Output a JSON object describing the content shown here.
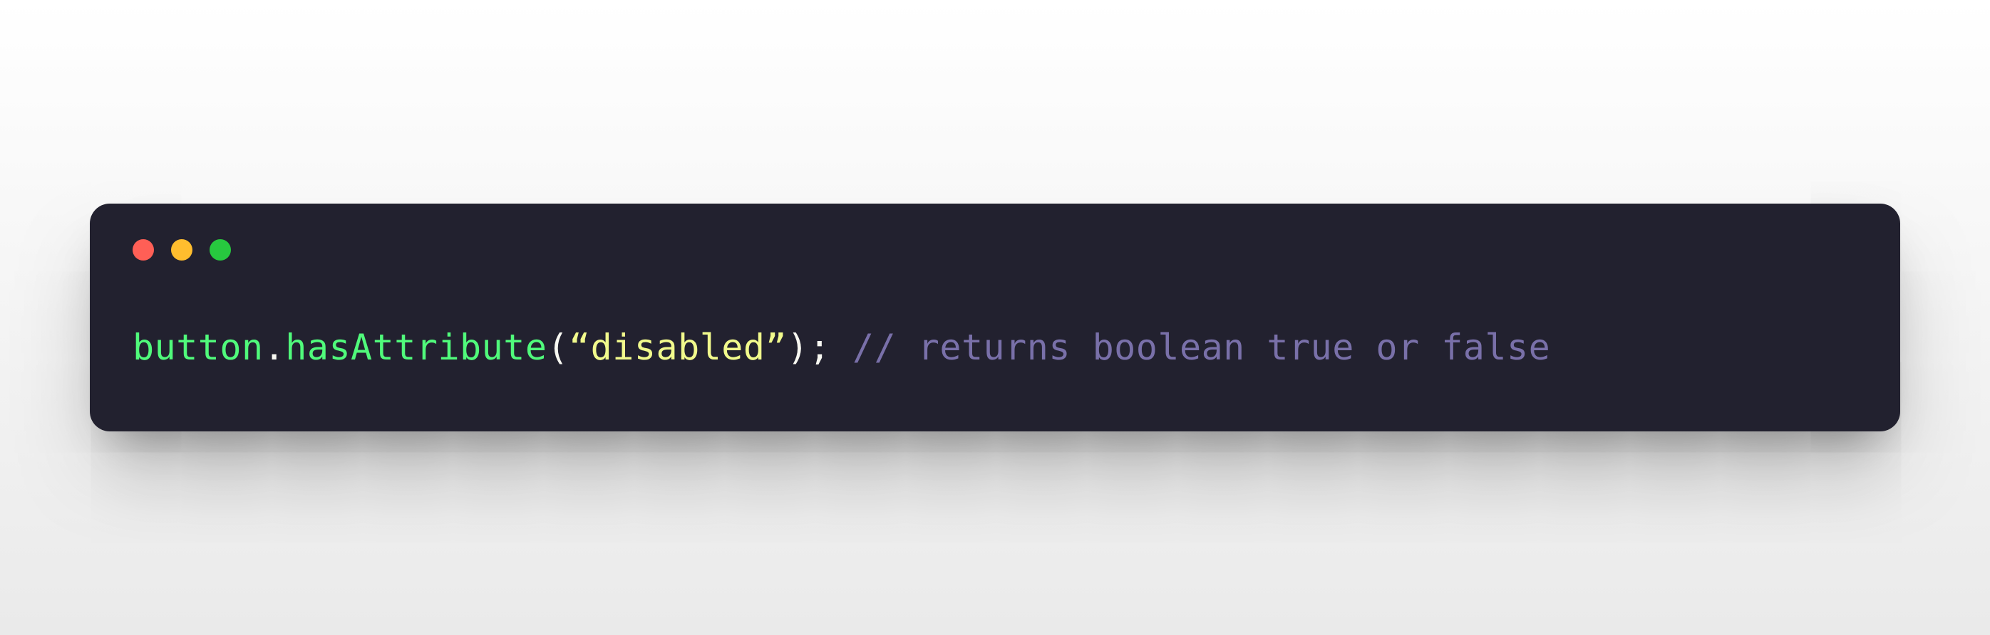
{
  "window": {
    "traffic_lights": {
      "red": "#ff5f56",
      "yellow": "#ffbd2e",
      "green": "#27c93f"
    }
  },
  "code": {
    "identifier": "button",
    "dot": ".",
    "method": "hasAttribute",
    "open_paren": "(",
    "string": "“disabled”",
    "close_paren_semi": ");",
    "space": " ",
    "comment": "// returns boolean true or false"
  }
}
